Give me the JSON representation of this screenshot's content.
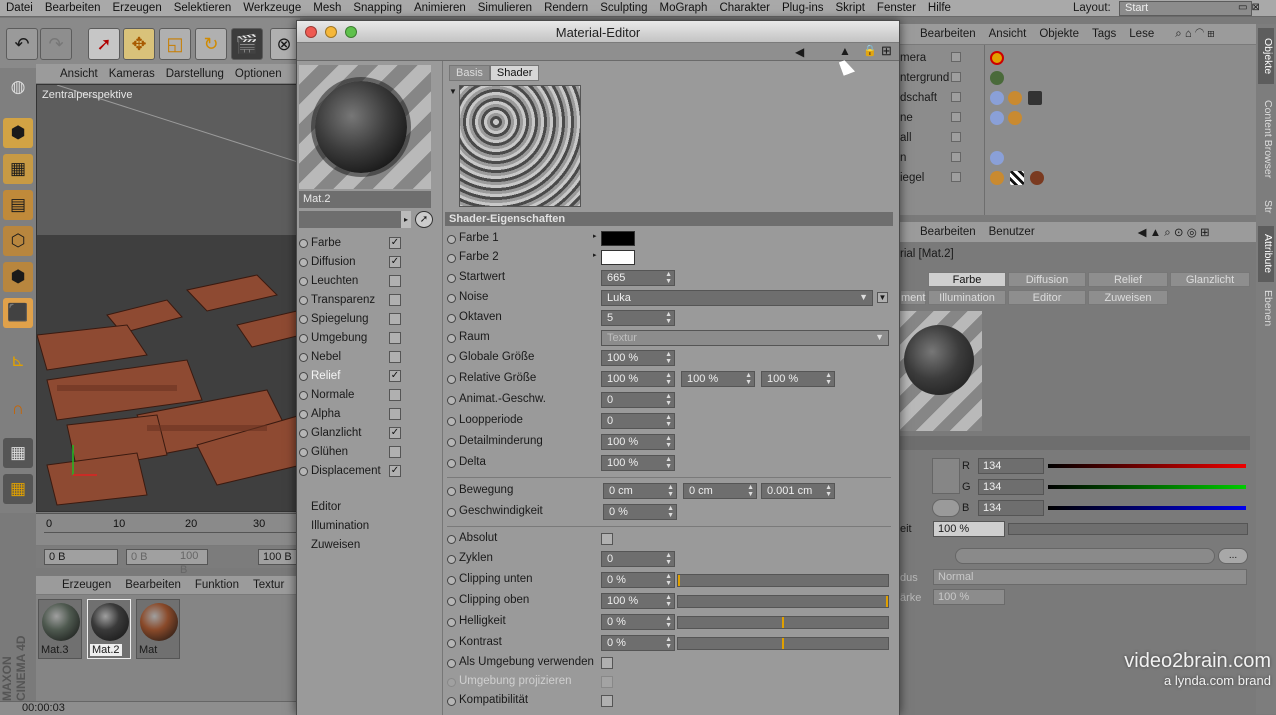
{
  "menubar": {
    "items": [
      "Datei",
      "Bearbeiten",
      "Erzeugen",
      "Selektieren",
      "Werkzeuge",
      "Mesh",
      "Snapping",
      "Animieren",
      "Simulieren",
      "Rendern",
      "Sculpting",
      "MoGraph",
      "Charakter",
      "Plug-ins",
      "Skript",
      "Fenster",
      "Hilfe"
    ],
    "layout_label": "Layout:",
    "layout_value": "Start"
  },
  "viewport": {
    "menu": [
      "Ansicht",
      "Kameras",
      "Darstellung",
      "Optionen"
    ],
    "label": "Zentralperspektive"
  },
  "timeline": {
    "ticks": [
      "0",
      "10",
      "20",
      "30"
    ],
    "frame_fields": [
      "0 B",
      "0 B",
      "100 B",
      "100 B"
    ]
  },
  "material_manager": {
    "menu": [
      "Erzeugen",
      "Bearbeiten",
      "Funktion",
      "Textur"
    ],
    "materials": [
      {
        "label": "Mat.3",
        "color": "#4f5a50"
      },
      {
        "label": "Mat.2",
        "color": "#3a3a3a"
      },
      {
        "label": "Mat",
        "color": "#8a4a2a"
      }
    ],
    "logo_line1": "MAXON",
    "logo_line2": "CINEMA 4D"
  },
  "status": {
    "time": "00:00:03"
  },
  "material_editor": {
    "title": "Material-Editor",
    "material_name": "Mat.2",
    "channels": [
      {
        "label": "Farbe",
        "checked": true
      },
      {
        "label": "Diffusion",
        "checked": true
      },
      {
        "label": "Leuchten",
        "checked": false
      },
      {
        "label": "Transparenz",
        "checked": false
      },
      {
        "label": "Spiegelung",
        "checked": false
      },
      {
        "label": "Umgebung",
        "checked": false
      },
      {
        "label": "Nebel",
        "checked": false
      },
      {
        "label": "Relief",
        "checked": true
      },
      {
        "label": "Normale",
        "checked": false
      },
      {
        "label": "Alpha",
        "checked": false
      },
      {
        "label": "Glanzlicht",
        "checked": true
      },
      {
        "label": "Glühen",
        "checked": false
      },
      {
        "label": "Displacement",
        "checked": true
      }
    ],
    "extra_items": [
      "Editor",
      "Illumination",
      "Zuweisen"
    ],
    "tabs": [
      "Basis",
      "Shader"
    ],
    "section_title": "Shader-Eigenschaften",
    "params": {
      "farbe1": {
        "label": "Farbe 1",
        "color": "#000000"
      },
      "farbe2": {
        "label": "Farbe 2",
        "color": "#ffffff"
      },
      "startwert": {
        "label": "Startwert",
        "value": "665"
      },
      "noise": {
        "label": "Noise",
        "value": "Luka"
      },
      "oktaven": {
        "label": "Oktaven",
        "value": "5"
      },
      "raum": {
        "label": "Raum",
        "value": "Textur"
      },
      "globale_groesse": {
        "label": "Globale Größe",
        "value": "100 %"
      },
      "relative_groesse": {
        "label": "Relative Größe",
        "values": [
          "100 %",
          "100 %",
          "100 %"
        ]
      },
      "animat_geschw": {
        "label": "Animat.-Geschw.",
        "value": "0"
      },
      "loopperiode": {
        "label": "Loopperiode",
        "value": "0"
      },
      "detailminderung": {
        "label": "Detailminderung",
        "value": "100 %"
      },
      "delta": {
        "label": "Delta",
        "value": "100 %"
      },
      "bewegung": {
        "label": "Bewegung",
        "values": [
          "0 cm",
          "0 cm",
          "0.001 cm"
        ]
      },
      "geschwindigkeit": {
        "label": "Geschwindigkeit",
        "value": "0 %"
      },
      "absolut": {
        "label": "Absolut"
      },
      "zyklen": {
        "label": "Zyklen",
        "value": "0"
      },
      "clipping_unten": {
        "label": "Clipping unten",
        "value": "0 %",
        "fraction": 0.0
      },
      "clipping_oben": {
        "label": "Clipping oben",
        "value": "100 %",
        "fraction": 1.0
      },
      "helligkeit": {
        "label": "Helligkeit",
        "value": "0 %",
        "fraction": 0.5
      },
      "kontrast": {
        "label": "Kontrast",
        "value": "0 %",
        "fraction": 0.5
      },
      "als_umgebung": {
        "label": "Als Umgebung verwenden"
      },
      "umgebung_proj": {
        "label": "Umgebung projizieren"
      },
      "kompatibilitaet": {
        "label": "Kompatibilität"
      }
    }
  },
  "object_manager": {
    "menu": [
      "Bearbeiten",
      "Ansicht",
      "Objekte",
      "Tags",
      "Lese"
    ],
    "objects": [
      "mera",
      "ntergrund",
      "dschaft",
      "ne",
      "all",
      "n",
      "iegel"
    ]
  },
  "attribute_manager": {
    "menu": [
      "Bearbeiten",
      "Benutzer"
    ],
    "title": "rial [Mat.2]",
    "tabs_row1": [
      "Farbe",
      "Diffusion",
      "Relief",
      "Glanzlicht"
    ],
    "tabs_row2": [
      "ment",
      "Illumination",
      "Editor",
      "Zuweisen"
    ],
    "rgb": [
      {
        "label": "R",
        "value": "134"
      },
      {
        "label": "G",
        "value": "134"
      },
      {
        "label": "B",
        "value": "134"
      }
    ],
    "helligkeit_label": "eit",
    "helligkeit_value": "100 %",
    "modus_label": "dus",
    "modus_value": "Normal",
    "staerke_label": "ärke",
    "staerke_value": "100 %"
  },
  "side_tabs": [
    "Objekte",
    "Content Browser",
    "Str",
    "Attribute",
    "Ebenen"
  ],
  "watermark": {
    "line1": "video2brain.com",
    "line2": "a lynda.com brand"
  }
}
